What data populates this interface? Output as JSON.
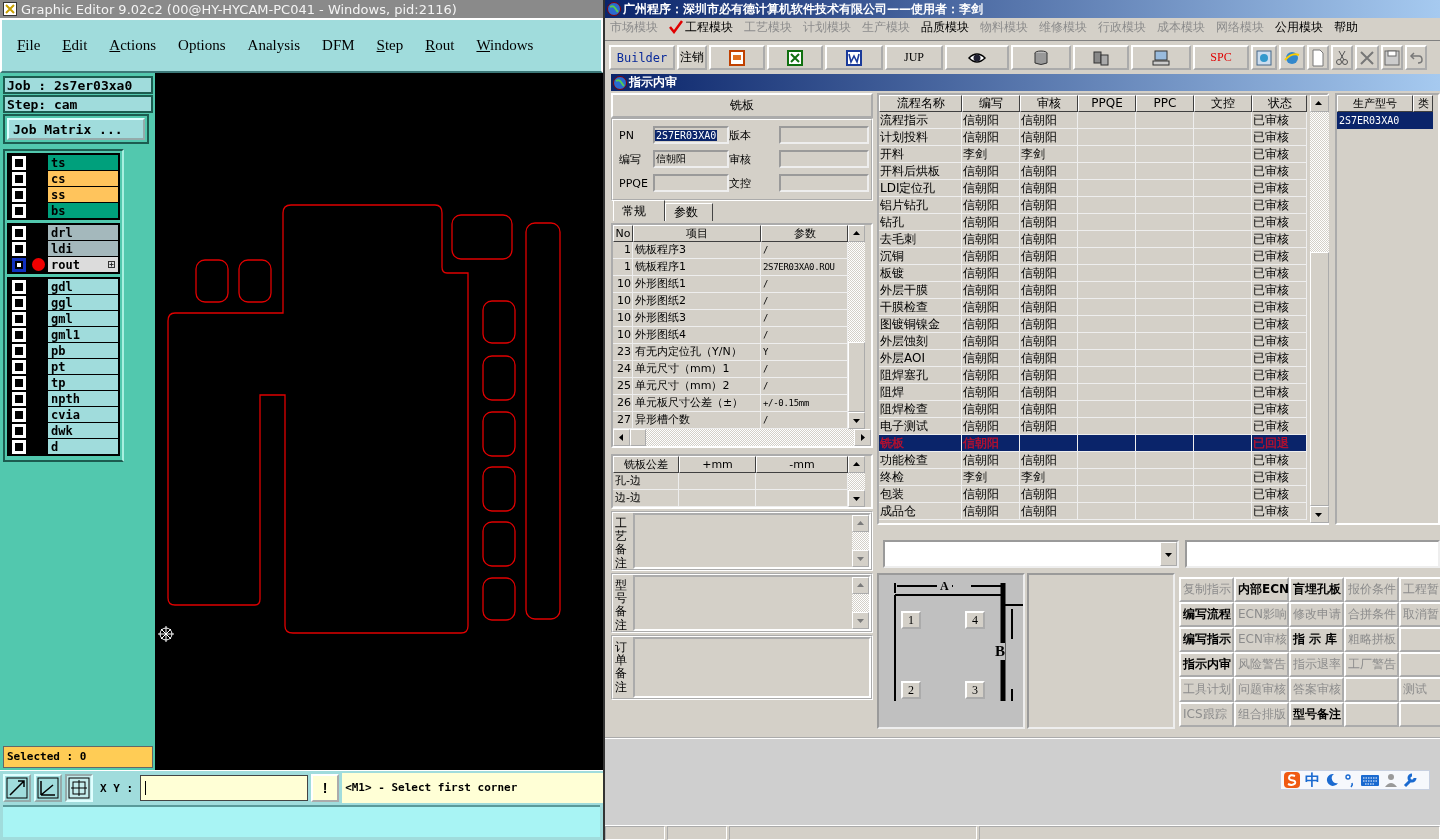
{
  "editor": {
    "title": "Graphic Editor 9.02c2 (00@HY-HYCAM-PC041 - Windows, pid:2116)",
    "menus": [
      {
        "label": "File",
        "mnemonic": true
      },
      {
        "label": "Edit",
        "mnemonic": true
      },
      {
        "label": "Actions",
        "mnemonic": true
      },
      {
        "label": "Options",
        "mnemonic": false
      },
      {
        "label": "Analysis",
        "mnemonic": false
      },
      {
        "label": "DFM",
        "mnemonic": false
      },
      {
        "label": "Step",
        "mnemonic": true
      },
      {
        "label": "Rout",
        "mnemonic": true
      },
      {
        "label": "Windows",
        "mnemonic": true
      }
    ],
    "job": "Job : 2s7er03xa0",
    "step": "Step: cam",
    "job_matrix": "Job Matrix ...",
    "layer_groups": [
      [
        {
          "name": "ts",
          "color": "#00a07c",
          "selected": false
        },
        {
          "name": "cs",
          "color": "#ffc45c",
          "selected": false
        },
        {
          "name": "ss",
          "color": "#ffc45c",
          "selected": false
        },
        {
          "name": "bs",
          "color": "#00a07c",
          "selected": false
        }
      ],
      [
        {
          "name": "drl",
          "color": "#a4b8bc",
          "selected": false
        },
        {
          "name": "ldi",
          "color": "#a4b8bc",
          "selected": false
        },
        {
          "name": "rout",
          "color": "#dcdcdc",
          "selected": true
        }
      ],
      [
        {
          "name": "gdl",
          "color": "#a0dcdc",
          "selected": false
        },
        {
          "name": "ggl",
          "color": "#a0dcdc",
          "selected": false
        },
        {
          "name": "gml",
          "color": "#a0dcdc",
          "selected": false
        },
        {
          "name": "gml1",
          "color": "#a0dcdc",
          "selected": false
        },
        {
          "name": "pb",
          "color": "#a0dcdc",
          "selected": false
        },
        {
          "name": "pt",
          "color": "#a0dcdc",
          "selected": false
        },
        {
          "name": "tp",
          "color": "#a0dcdc",
          "selected": false
        },
        {
          "name": "npth",
          "color": "#a0dcdc",
          "selected": false
        },
        {
          "name": "cvia",
          "color": "#a0dcdc",
          "selected": false
        },
        {
          "name": "dwk",
          "color": "#a0dcdc",
          "selected": false
        },
        {
          "name": "d",
          "color": "#a0dcdc",
          "selected": false
        }
      ]
    ],
    "selected_count": "Selected : 0",
    "xy_label": "X Y :",
    "alert_button": "!",
    "prompt": "<M1> - Select first corner"
  },
  "erp": {
    "title": "广州程序：深圳市必有德计算机软件技术有限公司——使用者：李剑",
    "modules": [
      {
        "label": "市场模块",
        "enabled": false,
        "checked": false
      },
      {
        "label": "工程模块",
        "enabled": true,
        "checked": true
      },
      {
        "label": "工艺模块",
        "enabled": false,
        "checked": false
      },
      {
        "label": "计划模块",
        "enabled": false,
        "checked": false
      },
      {
        "label": "生产模块",
        "enabled": false,
        "checked": false
      },
      {
        "label": "品质模块",
        "enabled": true,
        "checked": false
      },
      {
        "label": "物料模块",
        "enabled": false,
        "checked": false
      },
      {
        "label": "维修模块",
        "enabled": false,
        "checked": false
      },
      {
        "label": "行政模块",
        "enabled": false,
        "checked": false
      },
      {
        "label": "成本模块",
        "enabled": false,
        "checked": false
      },
      {
        "label": "网络模块",
        "enabled": false,
        "checked": false
      },
      {
        "label": "公用模块",
        "enabled": true,
        "checked": false
      },
      {
        "label": "帮助",
        "enabled": true,
        "checked": false
      }
    ],
    "toolbar": [
      {
        "kind": "text",
        "label": "Builder"
      },
      {
        "kind": "text",
        "label": "注销"
      },
      {
        "kind": "icon"
      },
      {
        "kind": "icon"
      },
      {
        "kind": "icon"
      },
      {
        "kind": "text",
        "label": "JUP"
      },
      {
        "kind": "icon"
      },
      {
        "kind": "icon"
      },
      {
        "kind": "icon"
      },
      {
        "kind": "icon"
      },
      {
        "kind": "text",
        "label": "SPC"
      },
      {
        "kind": "icon"
      },
      {
        "kind": "icon"
      },
      {
        "kind": "icon"
      },
      {
        "kind": "icon"
      },
      {
        "kind": "icon"
      },
      {
        "kind": "icon"
      },
      {
        "kind": "icon"
      }
    ],
    "child_title": "指示内审",
    "form": {
      "heading": "铣板",
      "fields": [
        {
          "label": "PN",
          "value": "2S7ER03XA0",
          "selected": true
        },
        {
          "label": "版本"
        },
        {
          "label": "编写",
          "value": "信朝阳",
          "selected": false
        },
        {
          "label": "审核"
        },
        {
          "label": "PPQE"
        },
        {
          "label": "文控"
        }
      ]
    },
    "tabs": [
      {
        "label": "常规",
        "selected": true
      },
      {
        "label": "参数",
        "selected": false
      }
    ],
    "params": {
      "columns": [
        "No",
        "项目",
        "参数"
      ],
      "rows": [
        {
          "no": "1",
          "item": "铣板程序3",
          "value": "/"
        },
        {
          "no": "1",
          "item": "铣板程序1",
          "value": "2S7ER03XA0.ROU"
        },
        {
          "no": "10",
          "item": "外形图纸1",
          "value": "/"
        },
        {
          "no": "10",
          "item": "外形图纸2",
          "value": "/"
        },
        {
          "no": "10",
          "item": "外形图纸3",
          "value": "/"
        },
        {
          "no": "10",
          "item": "外形图纸4",
          "value": "/"
        },
        {
          "no": "23",
          "item": "有无内定位孔（Y/N）",
          "value": "Y"
        },
        {
          "no": "24",
          "item": "单元尺寸（mm）1",
          "value": "/"
        },
        {
          "no": "25",
          "item": "单元尺寸（mm）2",
          "value": "/"
        },
        {
          "no": "26",
          "item": "单元板尺寸公差（±）",
          "value": "+/-0.15mm"
        },
        {
          "no": "27",
          "item": "异形槽个数",
          "value": "/"
        }
      ]
    },
    "tolerance": {
      "columns": [
        "铣板公差",
        "+mm",
        "-mm"
      ],
      "rows": [
        "孔-边",
        "边-边"
      ]
    },
    "notes": [
      "工艺备注",
      "型号备注",
      "订单备注"
    ],
    "flow": {
      "columns": [
        "流程名称",
        "编写",
        "审核",
        "PPQE",
        "PPC",
        "文控",
        "状态"
      ],
      "rows": [
        {
          "name": "流程指示",
          "writer": "信朝阳",
          "reviewer": "信朝阳",
          "status": "已审核",
          "selected": false
        },
        {
          "name": "计划投料",
          "writer": "信朝阳",
          "reviewer": "信朝阳",
          "status": "已审核",
          "selected": false
        },
        {
          "name": "开料",
          "writer": "李剑",
          "reviewer": "李剑",
          "status": "已审核",
          "selected": false
        },
        {
          "name": "开料后烘板",
          "writer": "信朝阳",
          "reviewer": "信朝阳",
          "status": "已审核",
          "selected": false
        },
        {
          "name": "LDI定位孔",
          "writer": "信朝阳",
          "reviewer": "信朝阳",
          "status": "已审核",
          "selected": false
        },
        {
          "name": "铝片钻孔",
          "writer": "信朝阳",
          "reviewer": "信朝阳",
          "status": "已审核",
          "selected": false
        },
        {
          "name": "钻孔",
          "writer": "信朝阳",
          "reviewer": "信朝阳",
          "status": "已审核",
          "selected": false
        },
        {
          "name": "去毛刺",
          "writer": "信朝阳",
          "reviewer": "信朝阳",
          "status": "已审核",
          "selected": false
        },
        {
          "name": "沉铜",
          "writer": "信朝阳",
          "reviewer": "信朝阳",
          "status": "已审核",
          "selected": false
        },
        {
          "name": "板镀",
          "writer": "信朝阳",
          "reviewer": "信朝阳",
          "status": "已审核",
          "selected": false
        },
        {
          "name": "外层干膜",
          "writer": "信朝阳",
          "reviewer": "信朝阳",
          "status": "已审核",
          "selected": false
        },
        {
          "name": "干膜检查",
          "writer": "信朝阳",
          "reviewer": "信朝阳",
          "status": "已审核",
          "selected": false
        },
        {
          "name": "图镀铜镍金",
          "writer": "信朝阳",
          "reviewer": "信朝阳",
          "status": "已审核",
          "selected": false
        },
        {
          "name": "外层蚀刻",
          "writer": "信朝阳",
          "reviewer": "信朝阳",
          "status": "已审核",
          "selected": false
        },
        {
          "name": "外层AOI",
          "writer": "信朝阳",
          "reviewer": "信朝阳",
          "status": "已审核",
          "selected": false
        },
        {
          "name": "阻焊塞孔",
          "writer": "信朝阳",
          "reviewer": "信朝阳",
          "status": "已审核",
          "selected": false
        },
        {
          "name": "阻焊",
          "writer": "信朝阳",
          "reviewer": "信朝阳",
          "status": "已审核",
          "selected": false
        },
        {
          "name": "阻焊检查",
          "writer": "信朝阳",
          "reviewer": "信朝阳",
          "status": "已审核",
          "selected": false
        },
        {
          "name": "电子测试",
          "writer": "信朝阳",
          "reviewer": "信朝阳",
          "status": "已审核",
          "selected": false
        },
        {
          "name": "铣板",
          "writer": "信朝阳",
          "status": "已回退",
          "selected": true
        },
        {
          "name": "功能检查",
          "writer": "信朝阳",
          "reviewer": "信朝阳",
          "status": "已审核",
          "selected": false
        },
        {
          "name": "终检",
          "writer": "李剑",
          "reviewer": "李剑",
          "status": "已审核",
          "selected": false
        },
        {
          "name": "包装",
          "writer": "信朝阳",
          "reviewer": "信朝阳",
          "status": "已审核",
          "selected": false
        },
        {
          "name": "成品仓",
          "writer": "信朝阳",
          "reviewer": "信朝阳",
          "status": "已审核",
          "selected": false
        }
      ]
    },
    "models": {
      "columns": [
        "生产型号",
        "类"
      ],
      "rows": [
        {
          "model": "2S7ER03XA0",
          "selected": true
        }
      ]
    },
    "diagram": {
      "width_label": "A",
      "height_label": "B",
      "corners": [
        "1",
        "4",
        "2",
        "3"
      ]
    },
    "buttons": [
      [
        {
          "kind": "button",
          "label": "复制指示",
          "enabled": false
        },
        {
          "kind": "button",
          "label": "内部ECN",
          "enabled": true
        },
        {
          "kind": "button",
          "label": "盲埋孔板",
          "enabled": true
        },
        {
          "kind": "button",
          "label": "报价条件",
          "enabled": false
        },
        {
          "kind": "button",
          "label": "工程暂",
          "enabled": false
        }
      ],
      [
        {
          "kind": "button",
          "label": "编写流程",
          "enabled": true
        },
        {
          "kind": "button",
          "label": "ECN影响",
          "enabled": false
        },
        {
          "kind": "button",
          "label": "修改申请",
          "enabled": false
        },
        {
          "kind": "button",
          "label": "合拼条件",
          "enabled": false
        },
        {
          "kind": "button",
          "label": "取消暂",
          "enabled": false
        }
      ],
      [
        {
          "kind": "button",
          "label": "编写指示",
          "enabled": true
        },
        {
          "kind": "button",
          "label": "ECN审核",
          "enabled": false
        },
        {
          "kind": "button",
          "label": "指 示 库",
          "enabled": true
        },
        {
          "kind": "button",
          "label": "粗略拼板",
          "enabled": false
        },
        {
          "kind": "blank"
        }
      ],
      [
        {
          "kind": "button",
          "label": "指示内审",
          "enabled": true
        },
        {
          "kind": "button",
          "label": "风险警告",
          "enabled": false
        },
        {
          "kind": "button",
          "label": "指示退率",
          "enabled": false
        },
        {
          "kind": "button",
          "label": "工厂警告",
          "enabled": false
        },
        {
          "kind": "blank"
        }
      ],
      [
        {
          "kind": "button",
          "label": "工具计划",
          "enabled": false
        },
        {
          "kind": "button",
          "label": "问题审核",
          "enabled": false
        },
        {
          "kind": "button",
          "label": "答案审核",
          "enabled": false
        },
        {
          "kind": "blank"
        },
        {
          "kind": "button",
          "label": "测试",
          "enabled": false
        }
      ],
      [
        {
          "kind": "button",
          "label": "ICS跟踪",
          "enabled": false
        },
        {
          "kind": "button",
          "label": "组合排版",
          "enabled": false
        },
        {
          "kind": "button",
          "label": "型号备注",
          "enabled": true
        },
        {
          "kind": "blank"
        },
        {
          "kind": "blank"
        }
      ]
    ],
    "ime": {
      "mode": "中"
    }
  }
}
